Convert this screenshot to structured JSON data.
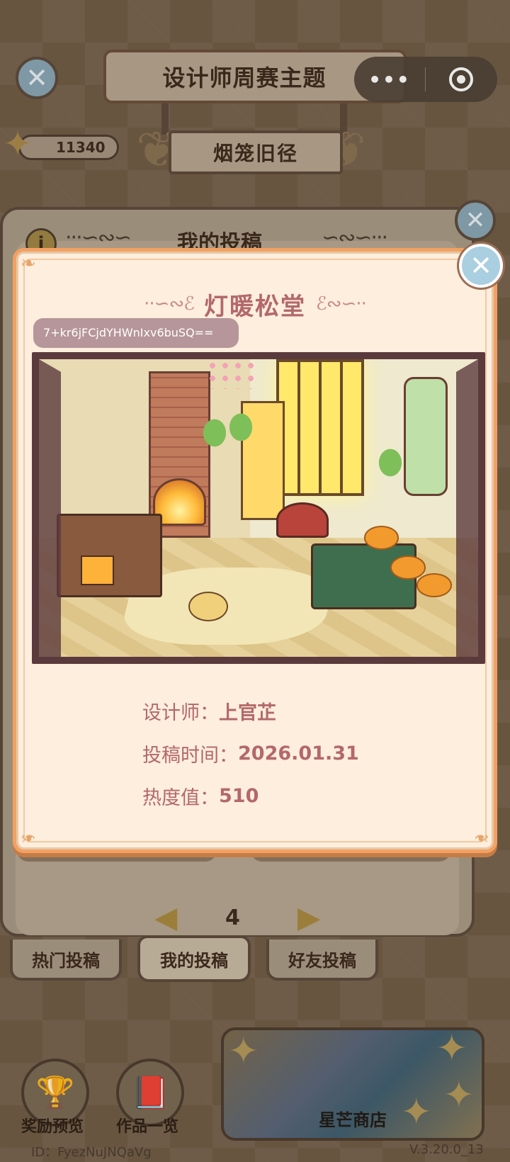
{
  "header": {
    "title": "设计师周赛主题",
    "theme": "烟笼旧径",
    "star_count": "11340",
    "capsule_more": "•••"
  },
  "background_panel": {
    "heading": "我的投稿",
    "page_number": "4",
    "tabs": [
      {
        "label": "热门投稿"
      },
      {
        "label": "我的投稿"
      },
      {
        "label": "好友投稿"
      }
    ]
  },
  "bottom": {
    "reward_preview": "奖励预览",
    "works_overview": "作品一览",
    "star_shop": "星芒商店",
    "player_id": "ID：FyezNuJNQaVg",
    "version": "V.3.20.0_13"
  },
  "modal": {
    "title": "灯暖松堂",
    "share_code": "7+kr6jFCjdYHWnIxv6buSQ==",
    "designer_label": "设计师：",
    "designer": "上官芷",
    "submit_time_label": "投稿时间：",
    "submit_time": "2026.01.31",
    "heat_label": "热度值：",
    "heat": "510"
  },
  "colors": {
    "modal_bg": "#fdeedd",
    "modal_border": "#f3a062",
    "accent_text": "#b3686a",
    "code_pill": "#b6969a",
    "close_button": "#a9cfe0"
  },
  "icons": {
    "close": "close-icon",
    "star": "star-icon",
    "info": "info-icon",
    "prev": "triangle-left-icon",
    "next": "triangle-right-icon",
    "trophy": "trophy-icon",
    "book": "book-icon",
    "more": "more-dots-icon",
    "target": "target-icon"
  }
}
